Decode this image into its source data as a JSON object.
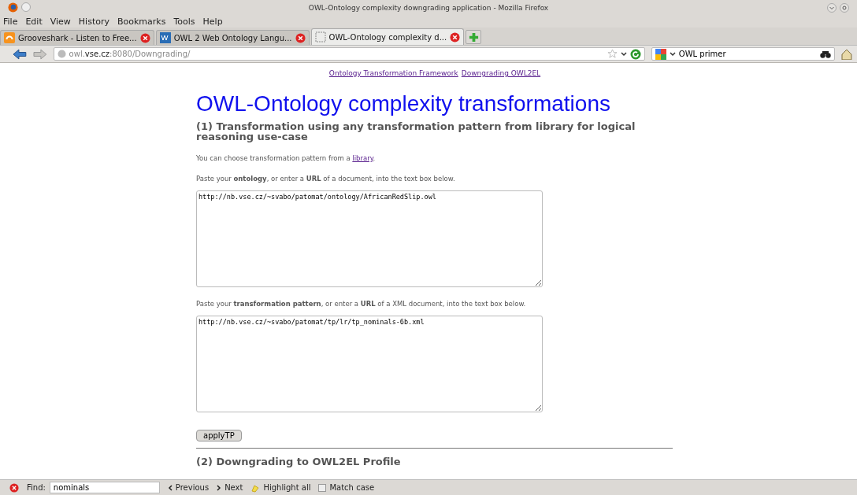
{
  "window": {
    "title": "OWL-Ontology complexity downgrading application - Mozilla Firefox"
  },
  "menu": [
    "File",
    "Edit",
    "View",
    "History",
    "Bookmarks",
    "Tools",
    "Help"
  ],
  "tabs": [
    {
      "label": "Grooveshark - Listen to Free...",
      "kind": "grooveshark",
      "selected": false
    },
    {
      "label": "OWL 2 Web Ontology Langu...",
      "kind": "w3c",
      "selected": false
    },
    {
      "label": "OWL-Ontology complexity d...",
      "kind": "blank",
      "selected": true
    }
  ],
  "address": {
    "prefix": "owl.",
    "domain": "vse.cz",
    "suffix": ":8080/Downgrading/"
  },
  "search": {
    "value": "OWL primer"
  },
  "page": {
    "top_links": [
      "Ontology Transformation Framework",
      "Downgrading OWL2EL"
    ],
    "title": "OWL-Ontology complexity transformations",
    "section1": "(1) Transformation using any transformation pattern from library for logical reasoning use-case",
    "library_text": "You can choose transformation pattern from a",
    "library_link": "library",
    "library_end": ".",
    "ontology_prompt": "Paste your **ontology**, or enter a **URL** of a document, into the text box below.",
    "ontology_value": "http://nb.vse.cz/~svabo/patomat/ontology/AfricanRedSlip.owl",
    "pattern_prompt": "Paste your **transformation pattern**, or enter a **URL** of a XML document, into the text box below.",
    "pattern_value": "http://nb.vse.cz/~svabo/patomat/tp/lr/tp_nominals-6b.xml",
    "apply_button": "applyTP",
    "section2": "(2) Downgrading to OWL2EL Profile"
  },
  "find_bar": {
    "label": "Find:",
    "value": "nominals",
    "previous": "Previous",
    "next": "Next",
    "highlight": "Highlight all",
    "match_case": {
      "label": "Match case",
      "checked": false
    }
  }
}
